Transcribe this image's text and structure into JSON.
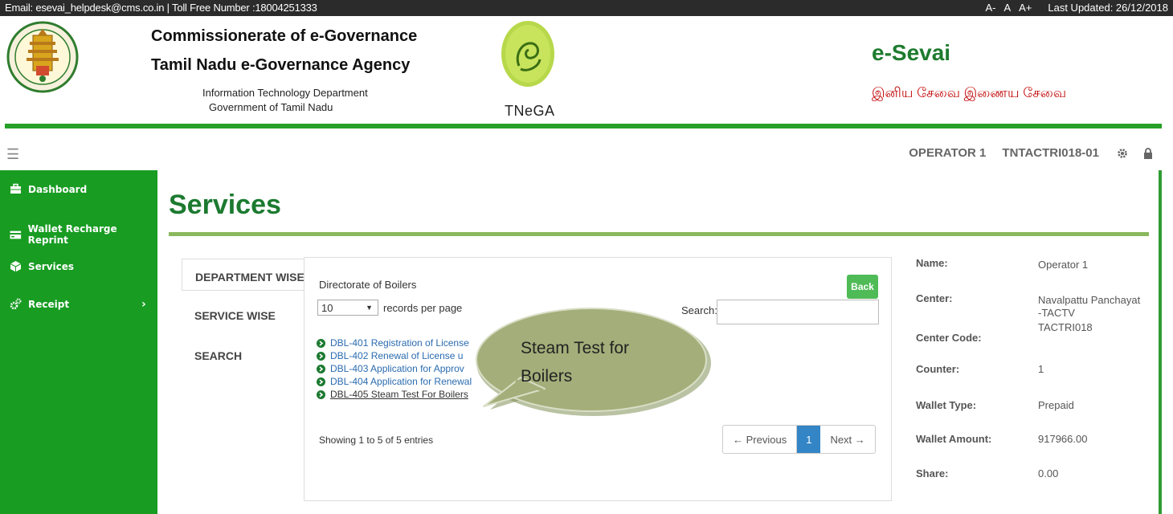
{
  "topbar": {
    "contact": "Email: esevai_helpdesk@cms.co.in | Toll Free Number :18004251333",
    "font_small": "A-",
    "font_normal": "A",
    "font_large": "A+",
    "last_updated": "Last Updated: 26/12/2018"
  },
  "header": {
    "org_line1": "Commissionerate of e-Governance",
    "org_line2": "Tamil Nadu e-Governance Agency",
    "org_line3": "Information Technology Department",
    "org_line4": "Government of Tamil Nadu",
    "tnega_label": "TNeGA",
    "brand": "e-Sevai",
    "tagline_tamil": "இனிய சேவை இணைய சேவை"
  },
  "navbar": {
    "operator": "OPERATOR 1",
    "center_id": "TNTACTRI018-01"
  },
  "sidebar": {
    "items": [
      {
        "label": "Dashboard",
        "icon": "briefcase-icon"
      },
      {
        "label": "Wallet Recharge Reprint",
        "icon": "card-icon"
      },
      {
        "label": "Services",
        "icon": "cube-icon"
      },
      {
        "label": "Receipt",
        "icon": "cogs-icon"
      }
    ]
  },
  "main": {
    "title": "Services",
    "tabs": [
      {
        "label": "DEPARTMENT WISE",
        "active": true
      },
      {
        "label": "SERVICE WISE",
        "active": false
      },
      {
        "label": "SEARCH",
        "active": false
      }
    ],
    "department": "Directorate of Boilers",
    "back_label": "Back",
    "page_length": "10",
    "records_label": "records per page",
    "search_label": "Search:",
    "search_value": "",
    "services": [
      "DBL-401 Registration of License",
      "DBL-402 Renewal of License u",
      "DBL-403 Application for Approv",
      "DBL-404 Application for Renewal",
      "DBL-405 Steam Test For Boilers"
    ],
    "showing": "Showing 1 to 5 of 5 entries",
    "prev_label": "← Previous",
    "current_page": "1",
    "next_label": "Next →"
  },
  "callout": {
    "line1": "Steam Test for",
    "line2": "Boilers"
  },
  "info": {
    "name_key": "Name:",
    "name_val": "Operator 1",
    "center_key": "Center:",
    "center_val1": "Navalpattu Panchayat",
    "center_val2": "-TACTV",
    "code_key": "Center Code:",
    "code_val": "TACTRI018",
    "counter_key": "Counter:",
    "counter_val": "1",
    "wallet_type_key": "Wallet Type:",
    "wallet_type_val": "Prepaid",
    "wallet_amount_key": "Wallet Amount:",
    "wallet_amount_val": "917966.00",
    "share_key": "Share:",
    "share_val": "0.00"
  }
}
